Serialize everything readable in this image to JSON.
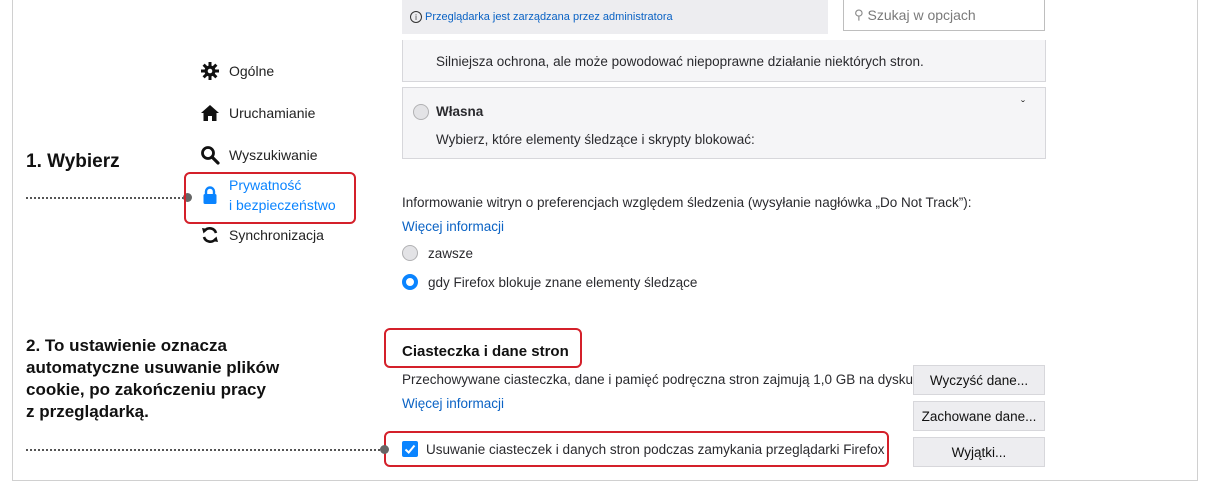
{
  "header": {
    "managed_notice": "Przeglądarka jest zarządzana przez administratora",
    "search_placeholder": "Szukaj w opcjach"
  },
  "sidebar": {
    "items": [
      {
        "label": "Ogólne",
        "icon": "gear-icon"
      },
      {
        "label": "Uruchamianie",
        "icon": "home-icon"
      },
      {
        "label": "Wyszukiwanie",
        "icon": "search-icon"
      },
      {
        "label_line1": "Prywatność",
        "label_line2": "i bezpieczeństwo",
        "icon": "lock-icon",
        "active": true
      },
      {
        "label": "Synchronizacja",
        "icon": "sync-icon"
      }
    ]
  },
  "tracking": {
    "strict_desc": "Silniejsza ochrona, ale może powodować niepoprawne działanie niektórych stron.",
    "custom_title": "Własna",
    "custom_desc": "Wybierz, które elementy śledzące i skrypty blokować:",
    "dnt_text": "Informowanie witryn o preferencjach względem śledzenia (wysyłanie nagłówka „Do Not Track”):",
    "more_info": "Więcej informacji",
    "option_always": "zawsze",
    "option_when_blocking": "gdy Firefox blokuje znane elementy śledzące"
  },
  "cookies": {
    "title": "Ciasteczka i dane stron",
    "storage_text": "Przechowywane ciasteczka, dane i pamięć podręczna stron zajmują 1,0 GB na dysku.",
    "more_info": "Więcej informacji",
    "clear_button": "Wyczyść dane...",
    "manage_button": "Zachowane dane...",
    "exceptions_button": "Wyjątki...",
    "delete_on_close": "Usuwanie ciasteczek i danych stron podczas zamykania przeglądarki Firefox"
  },
  "annotations": {
    "step1": "1. Wybierz",
    "step2_line1": "2. To ustawienie oznacza",
    "step2_line2": "automatyczne usuwanie plików",
    "step2_line3": "cookie, po zakończeniu pracy",
    "step2_line4": "z przeglądarką."
  },
  "colors": {
    "accent": "#0a84ff",
    "link": "#0a62c4",
    "highlight": "#d4202a"
  }
}
